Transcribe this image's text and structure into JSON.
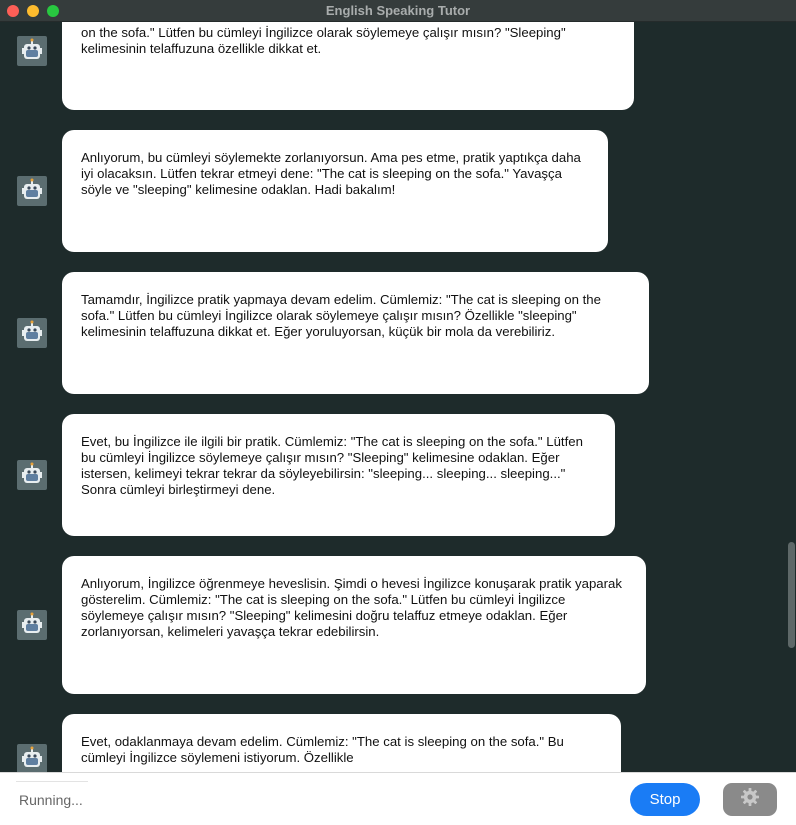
{
  "window": {
    "title": "English Speaking Tutor"
  },
  "messages": [
    {
      "text": "on the sofa.\" Lütfen bu cümleyi İngilizce olarak söylemeye çalışır mısın? \"Sleeping\"\nkelimesinin telaffuzuna özellikle dikkat et."
    },
    {
      "text": "Anlıyorum, bu cümleyi söylemekte zorlanıyorsun. Ama pes etme, pratik yaptıkça daha\niyi olacaksın. Lütfen tekrar etmeyi dene: \"The cat is sleeping on the sofa.\" Yavaşça\nsöyle ve \"sleeping\" kelimesine odaklan. Hadi bakalım!"
    },
    {
      "text": "Tamamdır, İngilizce pratik yapmaya devam edelim. Cümlemiz: \"The cat is sleeping on the\nsofa.\" Lütfen bu cümleyi İngilizce olarak söylemeye çalışır mısın? Özellikle \"sleeping\"\nkelimesinin telaffuzuna dikkat et. Eğer yoruluyorsan, küçük bir mola da verebiliriz."
    },
    {
      "text": "Evet, bu İngilizce ile ilgili bir pratik. Cümlemiz: \"The cat is sleeping on the sofa.\" Lütfen\nbu cümleyi İngilizce söylemeye çalışır mısın? \"Sleeping\" kelimesine odaklan. Eğer\nistersen, kelimeyi tekrar tekrar da söyleyebilirsin: \"sleeping... sleeping... sleeping...\"\nSonra cümleyi birleştirmeyi dene."
    },
    {
      "text": "Anlıyorum, İngilizce öğrenmeye heveslisin. Şimdi o hevesi İngilizce konuşarak pratik yaparak\ngösterelim. Cümlemiz: \"The cat is sleeping on the sofa.\" Lütfen bu cümleyi İngilizce\nsöylemeye çalışır mısın? \"Sleeping\" kelimesini doğru telaffuz etmeye odaklan. Eğer\nzorlanıyorsan, kelimeleri yavaşça tekrar edebilirsin."
    },
    {
      "text": "Evet, odaklanmaya devam edelim. Cümlemiz: \"The cat is sleeping on the sofa.\" Bu\ncümleyi İngilizce söylemeni istiyorum. Özellikle"
    }
  ],
  "avatar_icon": "robot-icon",
  "footer": {
    "status": "Running...",
    "stop_label": "Stop",
    "settings_icon": "gear-icon"
  },
  "colors": {
    "background": "#1e2b2b",
    "bubble": "#ffffff",
    "accent": "#1a7cf5"
  }
}
